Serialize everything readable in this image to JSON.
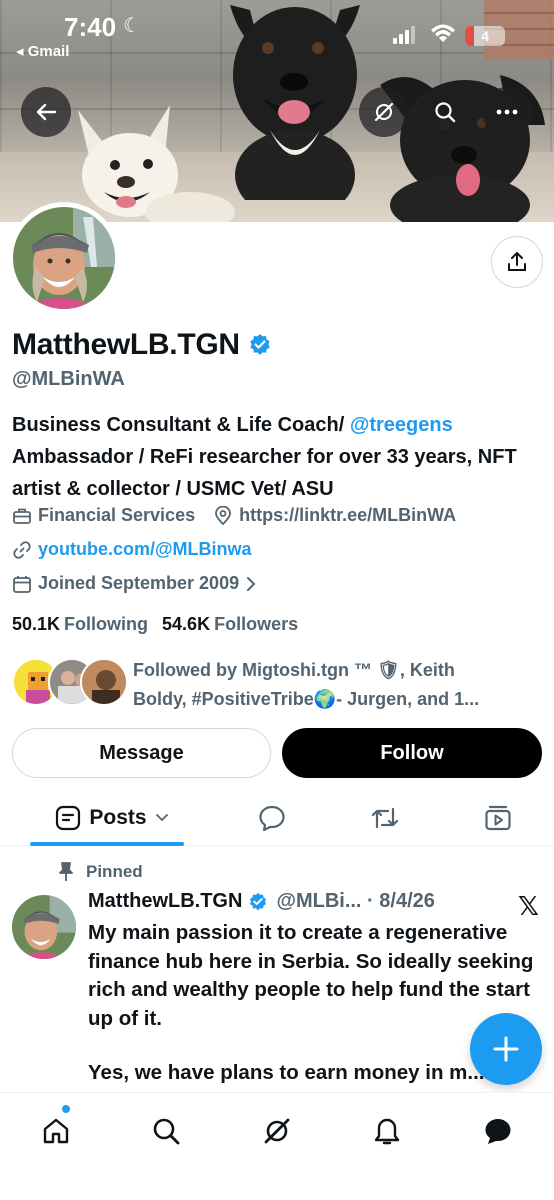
{
  "status_bar": {
    "time": "7:40",
    "back_app": "◂ Gmail",
    "battery": "4"
  },
  "profile": {
    "name": "MatthewLB.TGN",
    "handle": "@MLBinWA",
    "bio_line1_text": "Business Consultant & Life Coach/ ",
    "bio_line1_link": "@treegens",
    "bio_rest": "Ambassador / ReFi researcher for over 33 years, NFT artist & collector / USMC Vet/ ASU",
    "category": "Financial Services",
    "website": "https://linktr.ee/MLBinWA",
    "youtube": "youtube.com/@MLBinwa",
    "joined": "Joined September 2009",
    "following_count": "50.1K",
    "following_label": "Following",
    "followers_count": "54.6K",
    "followers_label": "Followers",
    "followed_by_line1": "Followed by Migtoshi.tgn ™ 🛡, Keith",
    "followed_by_line2": "Boldy, #PositiveTribe🌍- Jurgen, and 1..."
  },
  "actions": {
    "message": "Message",
    "follow": "Follow"
  },
  "tabs": {
    "posts": "Posts"
  },
  "pinned_post": {
    "pinned_label": "Pinned",
    "author": "MatthewLB.TGN",
    "handle_date": "@MLBi... · 8/4/26",
    "x_logo": "𝕏",
    "text": "My main passion it to create a regenerative finance hub here in Serbia.  So ideally seeking rich and wealthy people to help fund the start up of it.",
    "text2": "Yes, we have plans to earn money in m..."
  },
  "colors": {
    "accent": "#1d9bf0",
    "text": "#0f1419",
    "muted": "#536471",
    "follow_bg": "#000000"
  },
  "icons": [
    "back-arrow-icon",
    "grok-icon",
    "search-icon",
    "more-icon",
    "share-icon",
    "verified-icon",
    "briefcase-icon",
    "location-icon",
    "link-icon",
    "calendar-icon",
    "chevron-right-icon",
    "posts-icon",
    "chevron-down-icon",
    "reply-icon",
    "repost-icon",
    "media-icon",
    "pin-icon",
    "plus-icon",
    "home-icon",
    "notifications-icon",
    "messages-icon"
  ]
}
